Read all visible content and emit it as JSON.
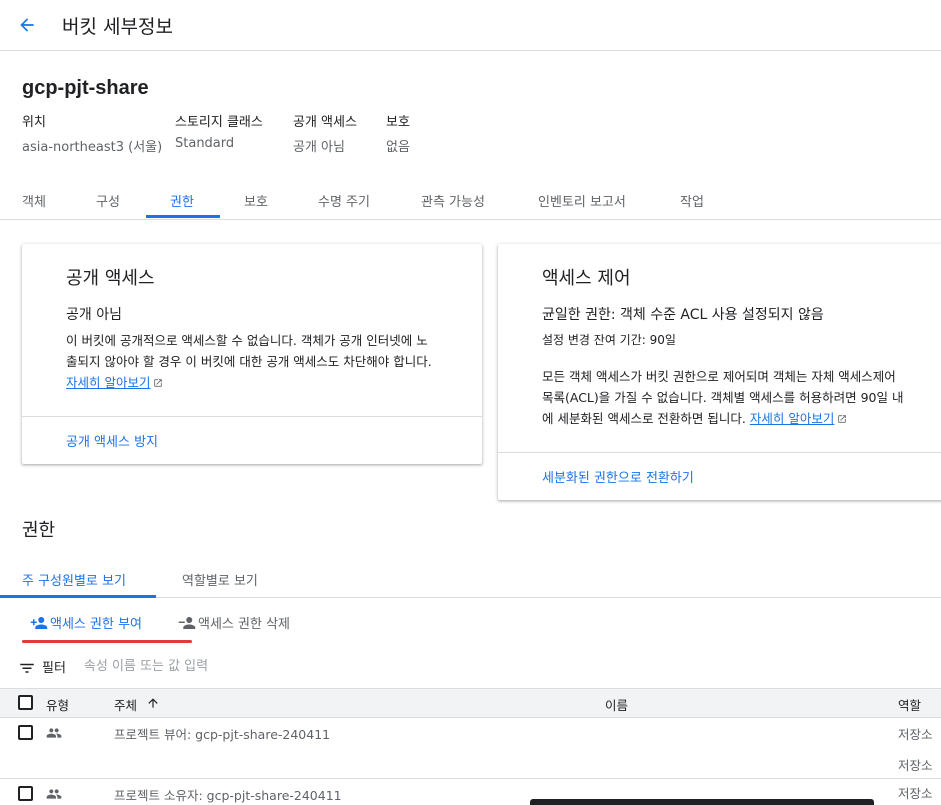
{
  "header": {
    "title": "버킷 세부정보"
  },
  "bucket": {
    "name": "gcp-pjt-share",
    "meta": [
      {
        "label": "위치",
        "value": "asia-northeast3 (서울)"
      },
      {
        "label": "스토리지 클래스",
        "value": "Standard"
      },
      {
        "label": "공개 액세스",
        "value": "공개 아님"
      },
      {
        "label": "보호",
        "value": "없음"
      }
    ]
  },
  "tabs": [
    "객체",
    "구성",
    "권한",
    "보호",
    "수명 주기",
    "관측 가능성",
    "인벤토리 보고서",
    "작업"
  ],
  "active_tab": "권한",
  "public_card": {
    "title": "공개 액세스",
    "status": "공개 아님",
    "body_line1": "이 버킷에 공개적으로 액세스할 수 없습니다. 객체가 공개 인터넷에 노",
    "body_line2": "출되지 않아야 할 경우 이 버킷에 대한 공개 액세스도 차단해야 합니다.",
    "learn_more": "자세히 알아보기",
    "action": "공개 액세스 방지"
  },
  "access_card": {
    "title": "액세스 제어",
    "status": "균일한 권한: 객체 수준 ACL 사용 설정되지 않음",
    "remaining": "설정 변경 잔여 기간: 90일",
    "body_line1": "모든 객체 액세스가 버킷 권한으로 제어되며 객체는 자체 액세스제어",
    "body_line2": "목록(ACL)을 가질 수 없습니다. 객체별 액세스를 허용하려면 90일 내",
    "body_line3": "에 세분화된 액세스로 전환하면 됩니다.",
    "learn_more": "자세히 알아보기",
    "action": "세분화된 권한으로 전환하기"
  },
  "permissions": {
    "heading": "권한",
    "subtabs": [
      "주 구성원별로 보기",
      "역할별로 보기"
    ],
    "grant_button": "액세스 권한 부여",
    "remove_button": "액세스 권한 삭제",
    "filter_label": "필터",
    "filter_placeholder": "속성 이름 또는 값 입력",
    "columns": {
      "type": "유형",
      "principal": "주체",
      "name": "이름",
      "role": "역할"
    },
    "rows": [
      {
        "principal": "프로젝트 뷰어: gcp-pjt-share-240411",
        "roles": [
          "저장소",
          "저장소"
        ]
      },
      {
        "principal": "프로젝트 소유자: gcp-pjt-share-240411",
        "roles": [
          "저장소"
        ]
      }
    ]
  },
  "colors": {
    "accent": "#1a73e8",
    "highlight": "#e53935",
    "divider": "#dadce0"
  }
}
